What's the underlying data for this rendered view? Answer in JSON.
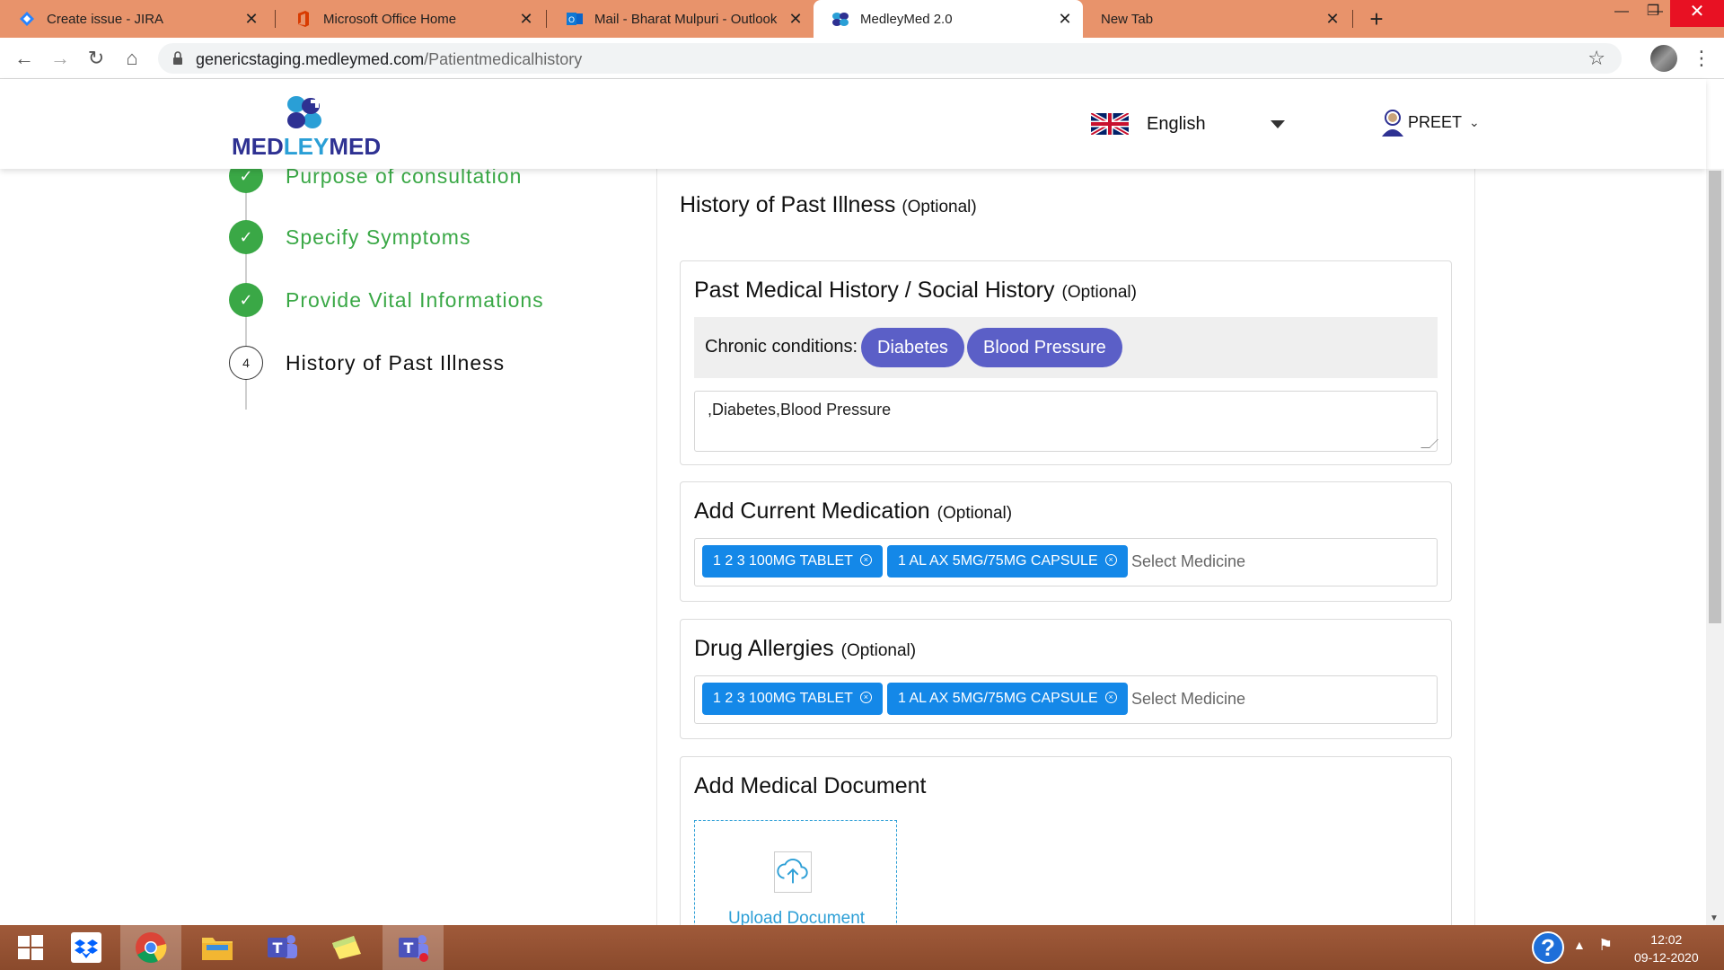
{
  "browser": {
    "tabs": [
      {
        "title": "Create issue - JIRA",
        "icon": "jira-icon"
      },
      {
        "title": "Microsoft Office Home",
        "icon": "office-icon"
      },
      {
        "title": "Mail - Bharat Mulpuri - Outlook",
        "icon": "outlook-icon"
      },
      {
        "title": "MedleyMed 2.0",
        "icon": "medleymed-icon",
        "active": true
      },
      {
        "title": "New Tab",
        "icon": ""
      }
    ],
    "url_domain": "genericstaging.medleymed.com",
    "url_path": "/Patientmedicalhistory"
  },
  "header": {
    "logo_text_a": "MED",
    "logo_text_b": "LEY",
    "logo_text_c": "MED",
    "language": "English",
    "user_name": "PREET"
  },
  "stepper": {
    "steps": [
      {
        "label": "Purpose of consultation",
        "status": "done"
      },
      {
        "label": "Specify Symptoms",
        "status": "done"
      },
      {
        "label": "Provide Vital Informations",
        "status": "done"
      },
      {
        "label": "History of Past Illness",
        "status": "current",
        "number": "4"
      }
    ]
  },
  "main": {
    "title": "History of Past Illness",
    "title_optional": "(Optional)",
    "past_history": {
      "title": "Past Medical History / Social History",
      "optional": "(Optional)",
      "chronic_label": "Chronic conditions:",
      "chips": [
        "Diabetes",
        "Blood Pressure"
      ],
      "notes": ",Diabetes,Blood Pressure"
    },
    "medication": {
      "title": "Add Current Medication",
      "optional": "(Optional)",
      "tags": [
        "1 2 3 100MG TABLET",
        "1 AL AX 5MG/75MG CAPSULE"
      ],
      "placeholder": "Select Medicine"
    },
    "allergies": {
      "title": "Drug Allergies",
      "optional": "(Optional)",
      "tags": [
        "1 2 3 100MG TABLET",
        "1 AL AX 5MG/75MG CAPSULE"
      ],
      "placeholder": "Select Medicine"
    },
    "document": {
      "title": "Add Medical Document",
      "upload_label": "Upload Document"
    }
  },
  "taskbar": {
    "time": "12:02",
    "date": "09-12-2020"
  },
  "colors": {
    "tabstrip": "#e8936b",
    "step_done": "#3aa846",
    "chip": "#5b5fc7",
    "tag": "#1488e8",
    "upload": "#2d9fd6"
  }
}
